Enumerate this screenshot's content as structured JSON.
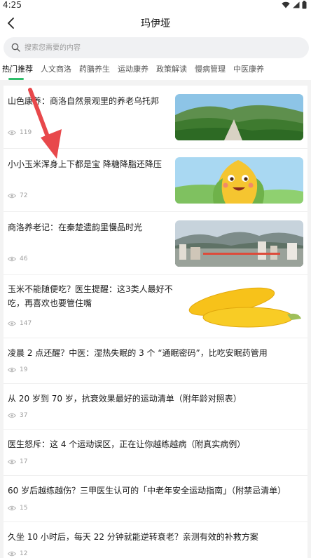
{
  "status_bar": {
    "time": "4:25"
  },
  "header": {
    "title": "玛伊垭"
  },
  "search": {
    "placeholder": "搜索您需要的内容"
  },
  "tabs": [
    {
      "label": "热门推荐",
      "active": true
    },
    {
      "label": "人文商洛",
      "active": false
    },
    {
      "label": "药膳养生",
      "active": false
    },
    {
      "label": "运动康养",
      "active": false
    },
    {
      "label": "政策解读",
      "active": false
    },
    {
      "label": "慢病管理",
      "active": false
    },
    {
      "label": "中医康养",
      "active": false
    }
  ],
  "accent_color": "#2fbf6b",
  "articles": [
    {
      "title": "山色康养：商洛自然景观里的养老乌托邦",
      "views": "119",
      "image": "mountain-landscape"
    },
    {
      "title": "小小玉米浑身上下都是宝 降糖降脂还降压",
      "views": "72",
      "image": "corn-cartoon"
    },
    {
      "title": "商洛养老记：在秦楚遗韵里慢品时光",
      "views": "46",
      "image": "city-mountains"
    },
    {
      "title": "玉米不能随便吃？医生提醒：这3类人最好不吃，再喜欢也要管住嘴",
      "views": "147",
      "image": "corn-cobs"
    },
    {
      "title": "凌晨 2 点还醒？中医：湿热失眠的 3 个 “通眠密码”，比吃安眠药管用",
      "views": "19"
    },
    {
      "title": "从 20 岁到 70 岁，抗衰效果最好的运动清单（附年龄对照表）",
      "views": "37"
    },
    {
      "title": "医生怒斥：这 4 个运动误区，正在让你越练越病（附真实病例）",
      "views": "17"
    },
    {
      "title": "60 岁后越练越伤？三甲医生认可的「中老年安全运动指南」（附禁忌清单）",
      "views": "15"
    },
    {
      "title": "久坐 10 小时后，每天 22 分钟就能逆转衰老？亲测有效的补救方案",
      "views": "12"
    }
  ]
}
